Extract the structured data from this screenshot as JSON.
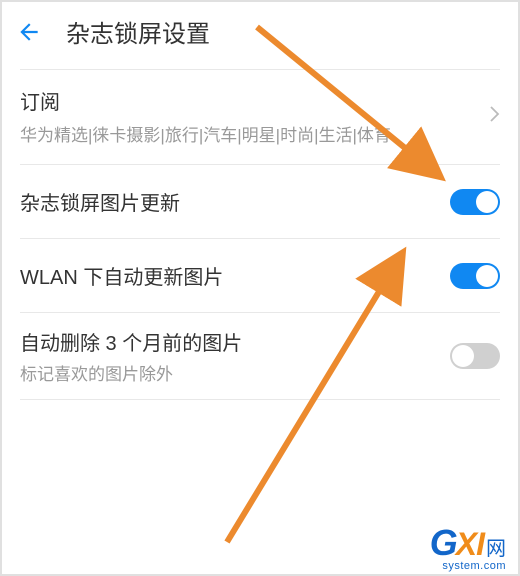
{
  "header": {
    "title": "杂志锁屏设置"
  },
  "subscription": {
    "title": "订阅",
    "desc": "华为精选|徕卡摄影|旅行|汽车|明星|时尚|生活|体育"
  },
  "rows": {
    "magazine_update": {
      "label": "杂志锁屏图片更新",
      "on": true
    },
    "wlan_auto": {
      "label": "WLAN 下自动更新图片",
      "on": true
    },
    "auto_delete": {
      "label": "自动删除 3 个月前的图片",
      "desc": "标记喜欢的图片除外",
      "on": false
    }
  },
  "watermark": {
    "g": "G",
    "xi": "XI",
    "net": "网",
    "host": "system.com"
  }
}
